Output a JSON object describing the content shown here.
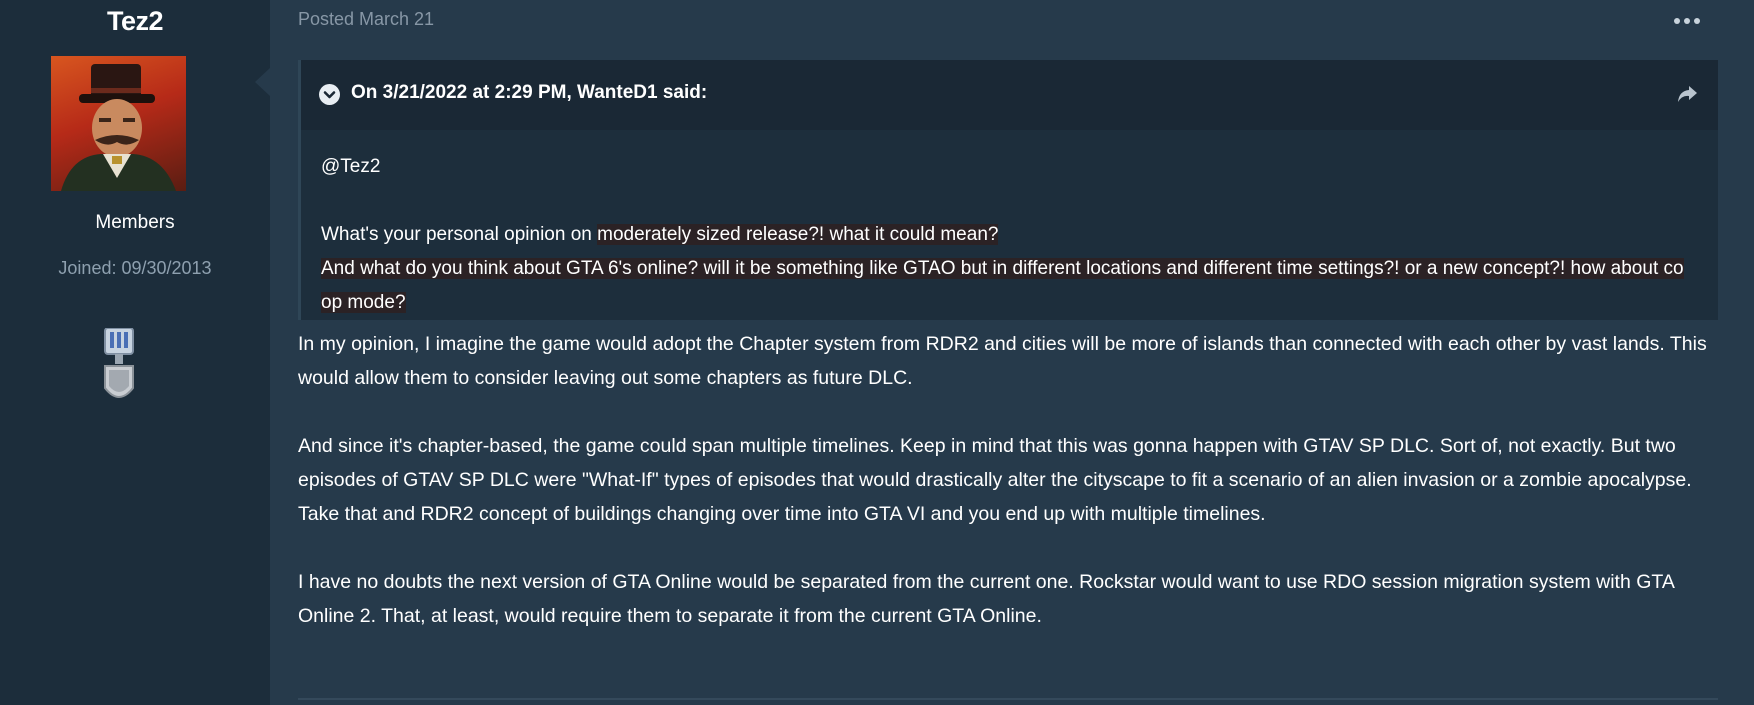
{
  "author": {
    "name": "Tez2",
    "group": "Members",
    "joined": "Joined: 09/30/2013"
  },
  "post": {
    "meta": "Posted March 21",
    "quote": {
      "citation": "On 3/21/2022 at 2:29 PM, WanteD1 said:",
      "mention": "@Tez2",
      "line1_plain": "What's your personal opinion on ",
      "line1_highlight": "moderately sized release?! what it could mean?",
      "line2": "And what do you think about GTA 6's online? will it be something like GTAO but in different locations and different time settings?! or a new concept?! how about co op mode?"
    },
    "paragraphs": [
      "In my opinion, I imagine the game would adopt the Chapter system from RDR2 and cities will be more of islands than connected with each other by vast lands. This would allow them to consider leaving out some chapters as future DLC.",
      "And since it's chapter-based, the game could span multiple timelines. Keep in mind that this was gonna happen with GTAV SP DLC. Sort of, not exactly. But two episodes of GTAV SP DLC were \"What-If\" types of episodes that would drastically alter the cityscape to fit a scenario of an alien invasion or a zombie apocalypse. Take that and RDR2 concept of buildings changing over time into GTA VI and you end up with multiple timelines.",
      "I have no doubts the next version of GTA Online would be separated from the current one. Rockstar would want to use RDO session migration system with GTA Online 2. That, at least, would require them to separate it from the current GTA Online."
    ]
  },
  "icons": {
    "menu": "ellipsis-icon",
    "toggle": "chevron-down-circle-icon",
    "share": "share-arrow-icon",
    "badge": "medal-icon"
  },
  "colors": {
    "background": "#263a4b",
    "sidebar": "#1c2d3b",
    "quote_bg": "#1d2e3c",
    "muted_text": "#8797a6"
  }
}
